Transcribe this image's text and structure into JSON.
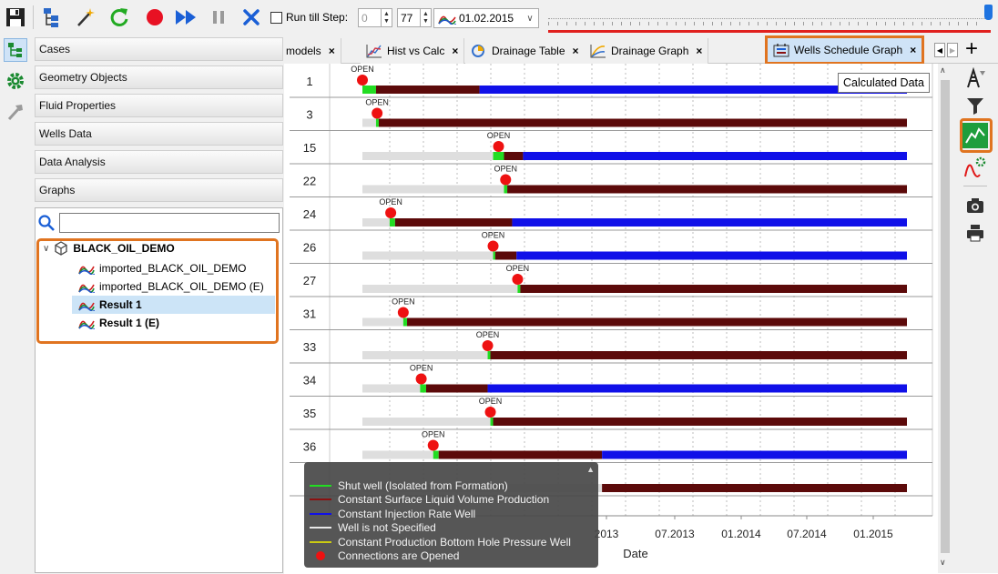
{
  "toolbar": {
    "run_till_label": "Run till Step:",
    "step_from": "0",
    "step_to": "77",
    "date_value": "01.02.2015"
  },
  "sidebar": {
    "sections": [
      "Cases",
      "Geometry Objects",
      "Fluid Properties",
      "Wells Data",
      "Data Analysis",
      "Graphs"
    ],
    "search": {
      "value": "",
      "placeholder": ""
    },
    "tree": {
      "root": "BLACK_OIL_DEMO",
      "children": [
        "imported_BLACK_OIL_DEMO",
        "imported_BLACK_OIL_DEMO (E)",
        "Result 1",
        "Result 1 (E)"
      ],
      "selected": "Result 1"
    }
  },
  "tabs": [
    {
      "label": "models",
      "icon": "none"
    },
    {
      "label": "Hist vs Calc",
      "icon": "hist-chart-icon"
    },
    {
      "label": "Drainage Table",
      "icon": "drainage-table-icon"
    },
    {
      "label": "Drainage Graph",
      "icon": "drainage-graph-icon"
    },
    {
      "label": "Wells Schedule Graph",
      "icon": "wells-schedule-icon",
      "active": true
    }
  ],
  "tooltip": "Calculated Data",
  "chart_data": {
    "type": "gantt",
    "xlabel": "Date",
    "xtick_labels": [
      "2013",
      "07.2013",
      "01.2014",
      "07.2014",
      "01.2015"
    ],
    "open_label": "OPEN",
    "colors": {
      "shut": "#22dd22",
      "production": "#5c0a0a",
      "injection": "#1010e8",
      "unspecified": "#dedede",
      "opened": "#ee1111"
    },
    "wells": [
      {
        "id": "1",
        "segments": [
          [
            "unspecified",
            0.0,
            0.0
          ],
          [
            "shut",
            0.0,
            0.025
          ],
          [
            "production",
            0.025,
            0.215
          ],
          [
            "injection",
            0.215,
            1.0
          ]
        ],
        "open_at": 0.0
      },
      {
        "id": "3",
        "segments": [
          [
            "unspecified",
            0.0,
            0.025
          ],
          [
            "shut",
            0.025,
            0.03
          ],
          [
            "production",
            0.03,
            1.0
          ]
        ],
        "open_at": 0.027
      },
      {
        "id": "15",
        "segments": [
          [
            "unspecified",
            0.0,
            0.24
          ],
          [
            "shut",
            0.24,
            0.26
          ],
          [
            "production",
            0.26,
            0.295
          ],
          [
            "injection",
            0.295,
            1.0
          ]
        ],
        "open_at": 0.25
      },
      {
        "id": "22",
        "segments": [
          [
            "unspecified",
            0.0,
            0.26
          ],
          [
            "shut",
            0.26,
            0.266
          ],
          [
            "production",
            0.266,
            1.0
          ]
        ],
        "open_at": 0.263
      },
      {
        "id": "24",
        "segments": [
          [
            "unspecified",
            0.0,
            0.05
          ],
          [
            "shut",
            0.05,
            0.06
          ],
          [
            "production",
            0.06,
            0.275
          ],
          [
            "injection",
            0.275,
            1.0
          ]
        ],
        "open_at": 0.052
      },
      {
        "id": "26",
        "segments": [
          [
            "unspecified",
            0.0,
            0.24
          ],
          [
            "shut",
            0.24,
            0.244
          ],
          [
            "production",
            0.244,
            0.283
          ],
          [
            "injection",
            0.283,
            1.0
          ]
        ],
        "open_at": 0.24
      },
      {
        "id": "27",
        "segments": [
          [
            "unspecified",
            0.0,
            0.285
          ],
          [
            "shut",
            0.285,
            0.29
          ],
          [
            "production",
            0.29,
            1.0
          ]
        ],
        "open_at": 0.285
      },
      {
        "id": "31",
        "segments": [
          [
            "unspecified",
            0.0,
            0.075
          ],
          [
            "shut",
            0.075,
            0.082
          ],
          [
            "production",
            0.082,
            1.0
          ]
        ],
        "open_at": 0.075
      },
      {
        "id": "33",
        "segments": [
          [
            "unspecified",
            0.0,
            0.23
          ],
          [
            "shut",
            0.23,
            0.235
          ],
          [
            "production",
            0.235,
            1.0
          ]
        ],
        "open_at": 0.23
      },
      {
        "id": "34",
        "segments": [
          [
            "unspecified",
            0.0,
            0.106
          ],
          [
            "shut",
            0.106,
            0.117
          ],
          [
            "production",
            0.117,
            0.23
          ],
          [
            "injection",
            0.23,
            1.0
          ]
        ],
        "open_at": 0.108
      },
      {
        "id": "35",
        "segments": [
          [
            "unspecified",
            0.0,
            0.235
          ],
          [
            "shut",
            0.235,
            0.24
          ],
          [
            "production",
            0.24,
            1.0
          ]
        ],
        "open_at": 0.235
      },
      {
        "id": "36",
        "segments": [
          [
            "unspecified",
            0.0,
            0.13
          ],
          [
            "shut",
            0.13,
            0.14
          ],
          [
            "production",
            0.14,
            0.44
          ],
          [
            "injection",
            0.44,
            1.0
          ]
        ],
        "open_at": 0.13
      },
      {
        "id": "",
        "segments": [
          [
            "unspecified",
            0.0,
            0.44
          ],
          [
            "production",
            0.44,
            1.0
          ]
        ],
        "open_at": null
      }
    ],
    "legend": [
      {
        "label": "Shut well (Isolated from Formation)",
        "color": "#22dd22",
        "kind": "line"
      },
      {
        "label": "Constant Surface Liquid Volume Production",
        "color": "#8b1111",
        "kind": "line"
      },
      {
        "label": "Constant Injection Rate Well",
        "color": "#1010e8",
        "kind": "line"
      },
      {
        "label": "Well is not Specified",
        "color": "#e8e8e8",
        "kind": "line"
      },
      {
        "label": "Constant Production Bottom Hole Pressure Well",
        "color": "#cccc11",
        "kind": "line"
      },
      {
        "label": "Connections are Opened",
        "color": "#ee1111",
        "kind": "dot"
      }
    ]
  }
}
